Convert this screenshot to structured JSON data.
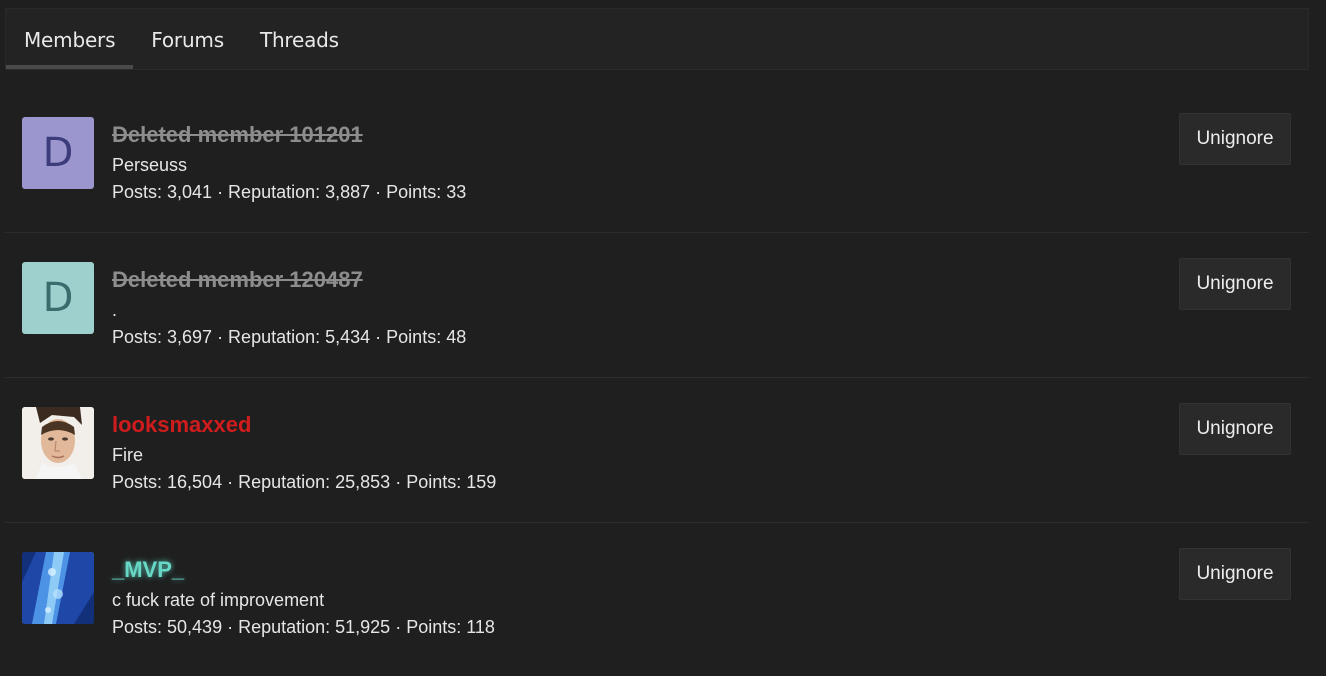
{
  "tabs": [
    {
      "label": "Members",
      "active": true
    },
    {
      "label": "Forums",
      "active": false
    },
    {
      "label": "Threads",
      "active": false
    }
  ],
  "members": [
    {
      "avatar_letter": "D",
      "avatar_style": "letter-purple",
      "username": "Deleted member 101201",
      "username_style": "deleted",
      "title": "Perseuss",
      "stats": "Posts: 3,041 · Reputation: 3,887 · Points: 33",
      "button": "Unignore"
    },
    {
      "avatar_letter": "D",
      "avatar_style": "letter-teal",
      "username": "Deleted member 120487",
      "username_style": "deleted",
      "title": ".",
      "stats": "Posts: 3,697 · Reputation: 5,434 · Points: 48",
      "button": "Unignore"
    },
    {
      "avatar_letter": "",
      "avatar_style": "photo-face",
      "username": "looksmaxxed",
      "username_style": "red",
      "title": "Fire",
      "stats": "Posts: 16,504 · Reputation: 25,853 · Points: 159",
      "button": "Unignore"
    },
    {
      "avatar_letter": "",
      "avatar_style": "photo-blue",
      "username": "_MVP_",
      "username_style": "mvp",
      "title": "c fuck rate of improvement",
      "stats": "Posts: 50,439 · Reputation: 51,925 · Points: 118",
      "button": "Unignore"
    }
  ],
  "colors": {
    "background": "#1f1f1f",
    "deleted_username": "#8d8d8d",
    "red_username": "#d01c1c",
    "mvp_username": "#69d7c6"
  }
}
